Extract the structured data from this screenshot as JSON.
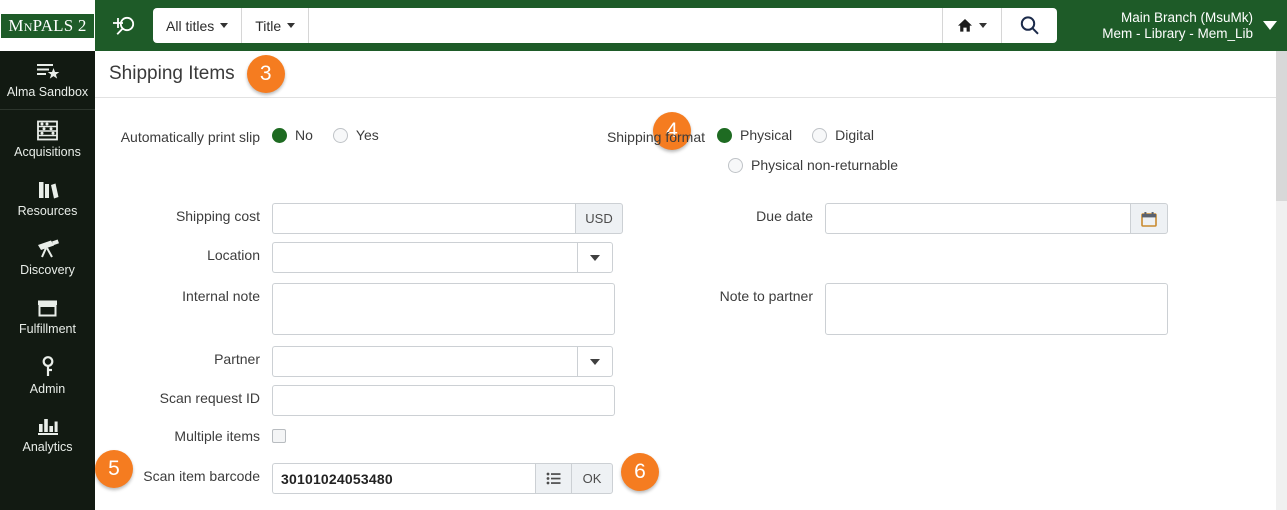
{
  "topbar": {
    "logo": "MnPALS 2",
    "adv_search_icon": "search-plus-icon",
    "scope_all": "All titles",
    "scope_field": "Title",
    "search_value": "",
    "search_placeholder": "",
    "home_icon": "home-icon",
    "go_icon": "search-icon",
    "user_line1": "Main Branch (MsuMk)",
    "user_line2": "Mem - Library - Mem_Lib"
  },
  "sidebar": {
    "items": [
      {
        "label": "Alma Sandbox",
        "icon": "list-star-icon"
      },
      {
        "label": "Acquisitions",
        "icon": "abacus-icon"
      },
      {
        "label": "Resources",
        "icon": "books-icon"
      },
      {
        "label": "Discovery",
        "icon": "telescope-icon"
      },
      {
        "label": "Fulfillment",
        "icon": "box-icon"
      },
      {
        "label": "Admin",
        "icon": "key-icon"
      },
      {
        "label": "Analytics",
        "icon": "bar-chart-icon"
      }
    ]
  },
  "page": {
    "title": "Shipping Items",
    "badges": {
      "title": "3",
      "shipping_format": "4",
      "scan_barcode": "5",
      "ok": "6"
    }
  },
  "form": {
    "auto_print": {
      "label": "Automatically print slip",
      "options": [
        {
          "label": "No",
          "selected": true
        },
        {
          "label": "Yes",
          "selected": false
        }
      ]
    },
    "shipping_format": {
      "label": "Shipping format",
      "options": [
        {
          "label": "Physical",
          "selected": true
        },
        {
          "label": "Digital",
          "selected": false
        },
        {
          "label": "Physical non-returnable",
          "selected": false
        }
      ]
    },
    "shipping_cost": {
      "label": "Shipping cost",
      "value": "",
      "currency": "USD"
    },
    "due_date": {
      "label": "Due date",
      "value": "",
      "icon": "calendar-icon"
    },
    "location": {
      "label": "Location",
      "value": "",
      "icon": "chevron-down-icon"
    },
    "internal_note": {
      "label": "Internal note",
      "value": ""
    },
    "note_to_partner": {
      "label": "Note to partner",
      "value": ""
    },
    "partner": {
      "label": "Partner",
      "value": "",
      "icon": "chevron-down-icon"
    },
    "scan_request_id": {
      "label": "Scan request ID",
      "value": ""
    },
    "multiple_items": {
      "label": "Multiple items",
      "checked": false
    },
    "scan_item_barcode": {
      "label": "Scan item barcode",
      "value": "30101024053480",
      "list_icon": "list-icon",
      "ok_label": "OK"
    }
  },
  "colors": {
    "header_green": "#1e5b28",
    "sidebar_dark": "#121a12",
    "badge_orange": "#f57c20",
    "radio_selected": "#1e6b22"
  }
}
